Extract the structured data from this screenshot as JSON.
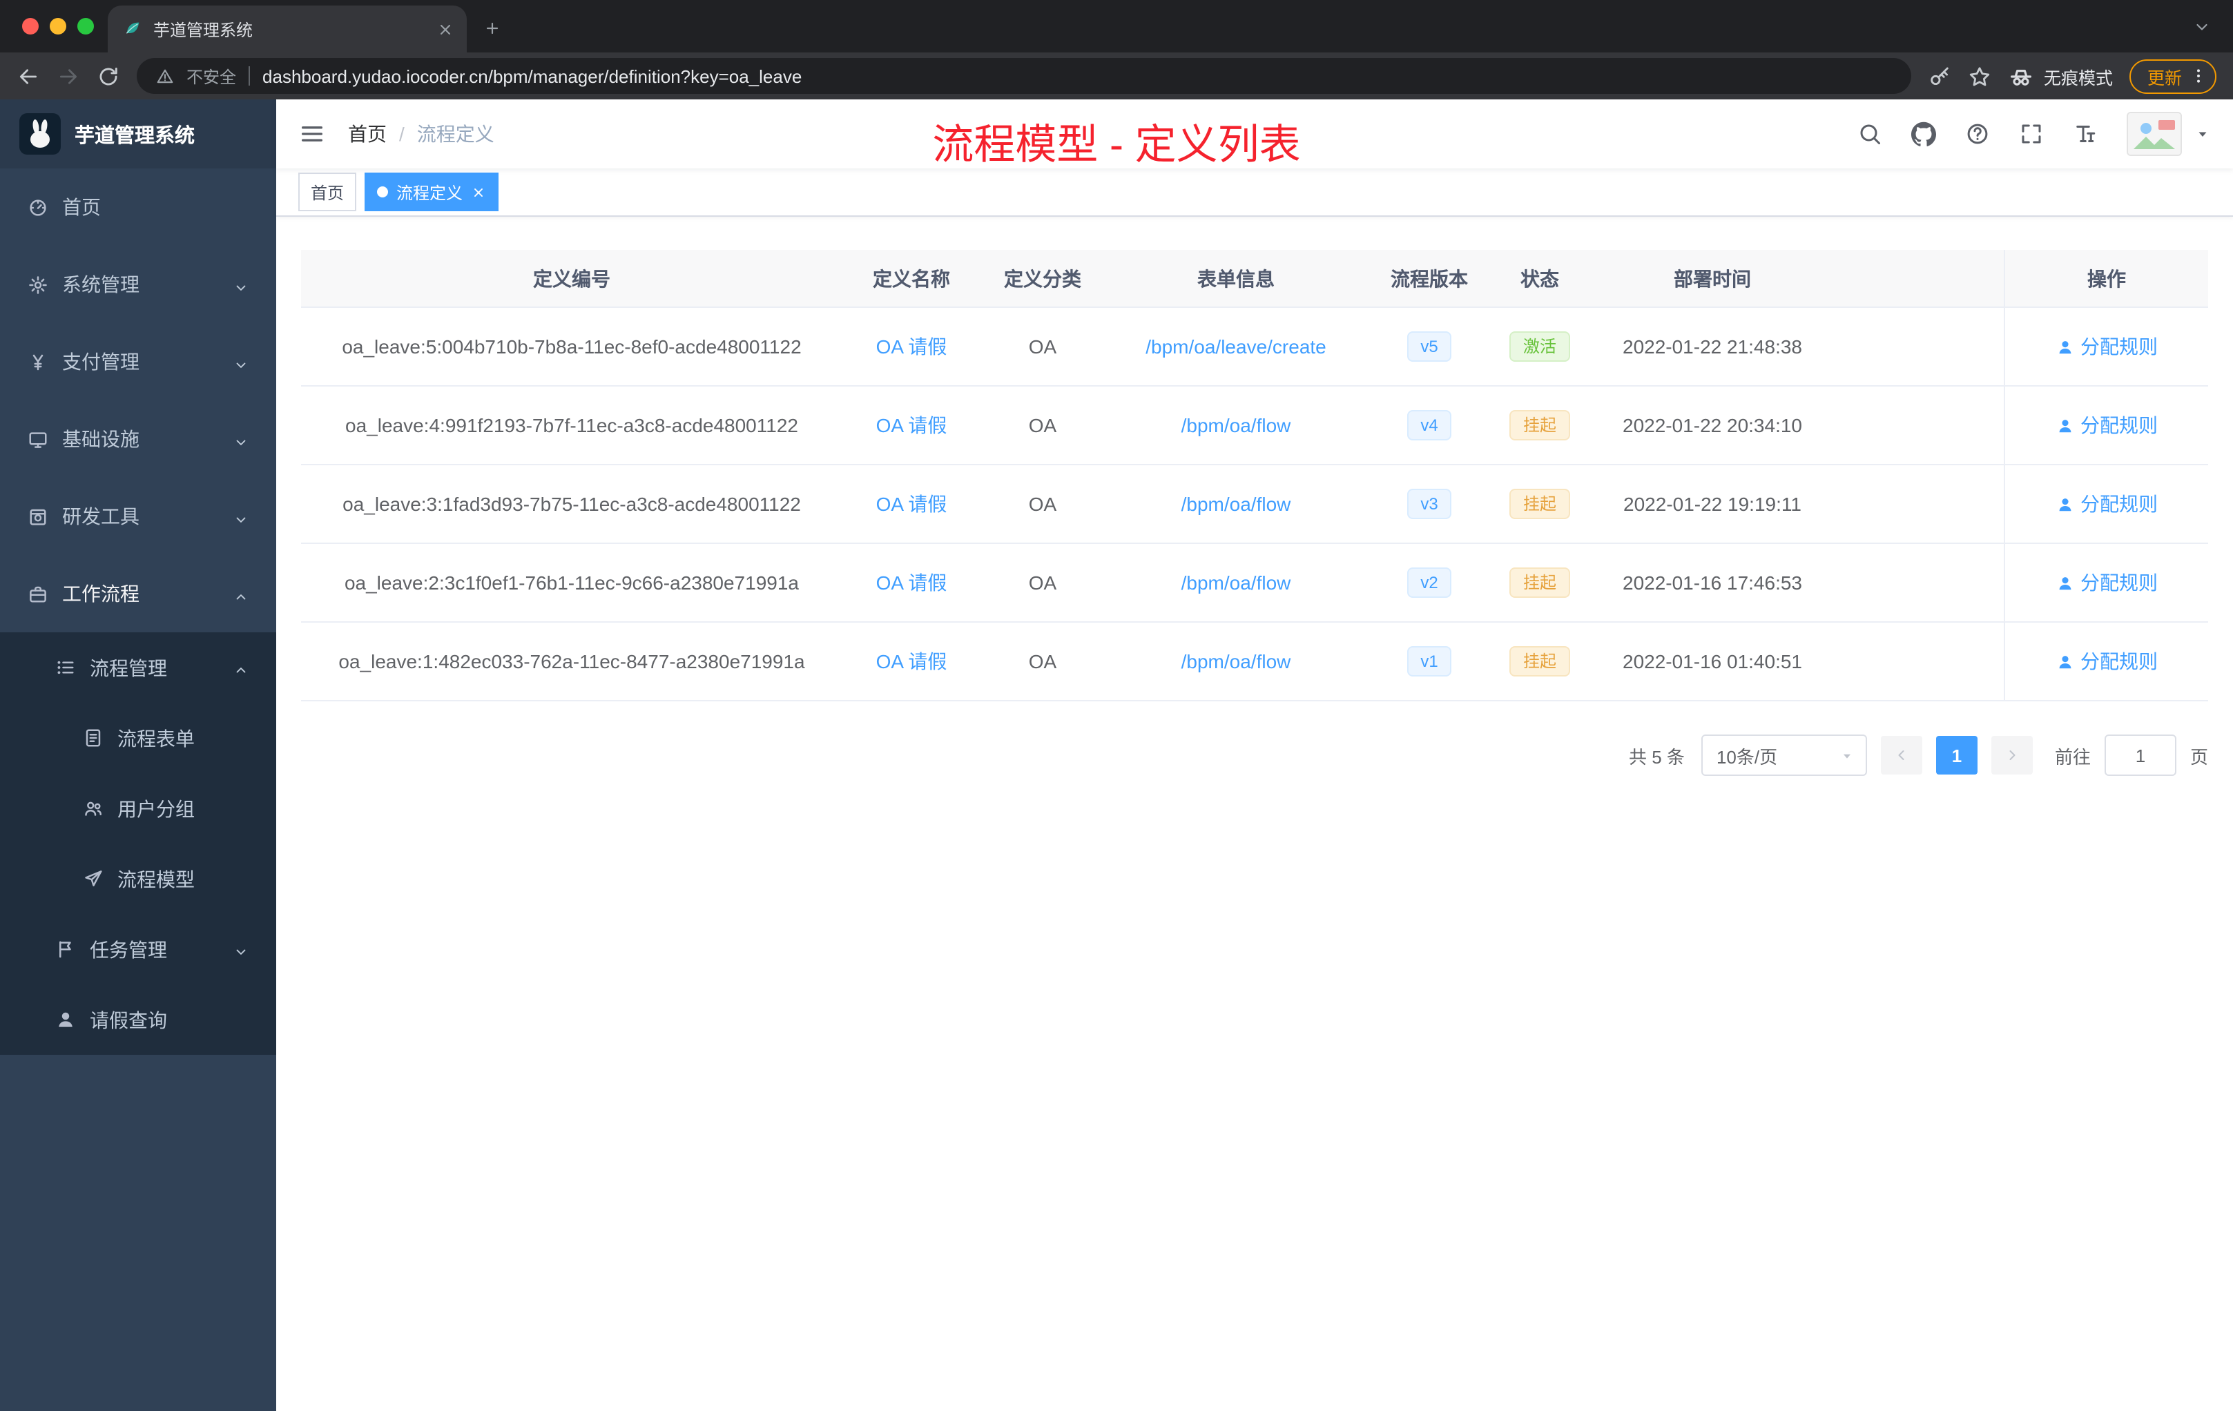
{
  "browser": {
    "tab_title": "芋道管理系统",
    "security_label": "不安全",
    "url": "dashboard.yudao.iocoder.cn/bpm/manager/definition?key=oa_leave",
    "incognito_label": "无痕模式",
    "update_label": "更新"
  },
  "sidebar": {
    "logo_title": "芋道管理系统",
    "items": [
      {
        "label": "首页",
        "icon": "dashboard-icon",
        "level": 1
      },
      {
        "label": "系统管理",
        "icon": "gear-icon",
        "level": 1,
        "chevron": "down"
      },
      {
        "label": "支付管理",
        "icon": "yen-icon",
        "level": 1,
        "chevron": "down"
      },
      {
        "label": "基础设施",
        "icon": "monitor-icon",
        "level": 1,
        "chevron": "down"
      },
      {
        "label": "研发工具",
        "icon": "safe-icon",
        "level": 1,
        "chevron": "down"
      },
      {
        "label": "工作流程",
        "icon": "briefcase-icon",
        "level": 1,
        "chevron": "up",
        "active": true
      },
      {
        "label": "流程管理",
        "icon": "list-icon",
        "level": 2,
        "chevron": "up"
      },
      {
        "label": "流程表单",
        "icon": "form-icon",
        "level": 3
      },
      {
        "label": "用户分组",
        "icon": "users-icon",
        "level": 3
      },
      {
        "label": "流程模型",
        "icon": "plane-icon",
        "level": 3
      },
      {
        "label": "任务管理",
        "icon": "task-icon",
        "level": 2,
        "chevron": "down"
      },
      {
        "label": "请假查询",
        "icon": "user-icon",
        "level": 2
      }
    ]
  },
  "header": {
    "breadcrumb": [
      {
        "label": "首页"
      },
      {
        "label": "流程定义"
      }
    ],
    "page_title": "流程模型 - 定义列表"
  },
  "tags": [
    {
      "label": "首页",
      "active": false,
      "closable": false
    },
    {
      "label": "流程定义",
      "active": true,
      "closable": true
    }
  ],
  "table": {
    "columns": [
      "定义编号",
      "定义名称",
      "定义分类",
      "表单信息",
      "流程版本",
      "状态",
      "部署时间",
      "操作"
    ],
    "rows": [
      {
        "id": "oa_leave:5:004b710b-7b8a-11ec-8ef0-acde48001122",
        "name": "OA 请假",
        "category": "OA",
        "form": "/bpm/oa/leave/create",
        "version": "v5",
        "status": "激活",
        "status_type": "success",
        "deploy_time": "2022-01-22 21:48:38",
        "action": "分配规则"
      },
      {
        "id": "oa_leave:4:991f2193-7b7f-11ec-a3c8-acde48001122",
        "name": "OA 请假",
        "category": "OA",
        "form": "/bpm/oa/flow",
        "version": "v4",
        "status": "挂起",
        "status_type": "warning",
        "deploy_time": "2022-01-22 20:34:10",
        "action": "分配规则"
      },
      {
        "id": "oa_leave:3:1fad3d93-7b75-11ec-a3c8-acde48001122",
        "name": "OA 请假",
        "category": "OA",
        "form": "/bpm/oa/flow",
        "version": "v3",
        "status": "挂起",
        "status_type": "warning",
        "deploy_time": "2022-01-22 19:19:11",
        "action": "分配规则"
      },
      {
        "id": "oa_leave:2:3c1f0ef1-76b1-11ec-9c66-a2380e71991a",
        "name": "OA 请假",
        "category": "OA",
        "form": "/bpm/oa/flow",
        "version": "v2",
        "status": "挂起",
        "status_type": "warning",
        "deploy_time": "2022-01-16 17:46:53",
        "action": "分配规则"
      },
      {
        "id": "oa_leave:1:482ec033-762a-11ec-8477-a2380e71991a",
        "name": "OA 请假",
        "category": "OA",
        "form": "/bpm/oa/flow",
        "version": "v1",
        "status": "挂起",
        "status_type": "warning",
        "deploy_time": "2022-01-16 01:40:51",
        "action": "分配规则"
      }
    ]
  },
  "pagination": {
    "total_label": "共 5 条",
    "page_size": "10条/页",
    "current_page": "1",
    "goto_label": "前往",
    "goto_value": "1",
    "page_unit": "页"
  },
  "colors": {
    "accent": "#409eff",
    "page_title_red": "#f5222d",
    "status_success": "#67c23a",
    "status_warning": "#e6a23c",
    "sidebar_bg": "#304156",
    "sidebar_submenu_bg": "#1f2d3d"
  }
}
